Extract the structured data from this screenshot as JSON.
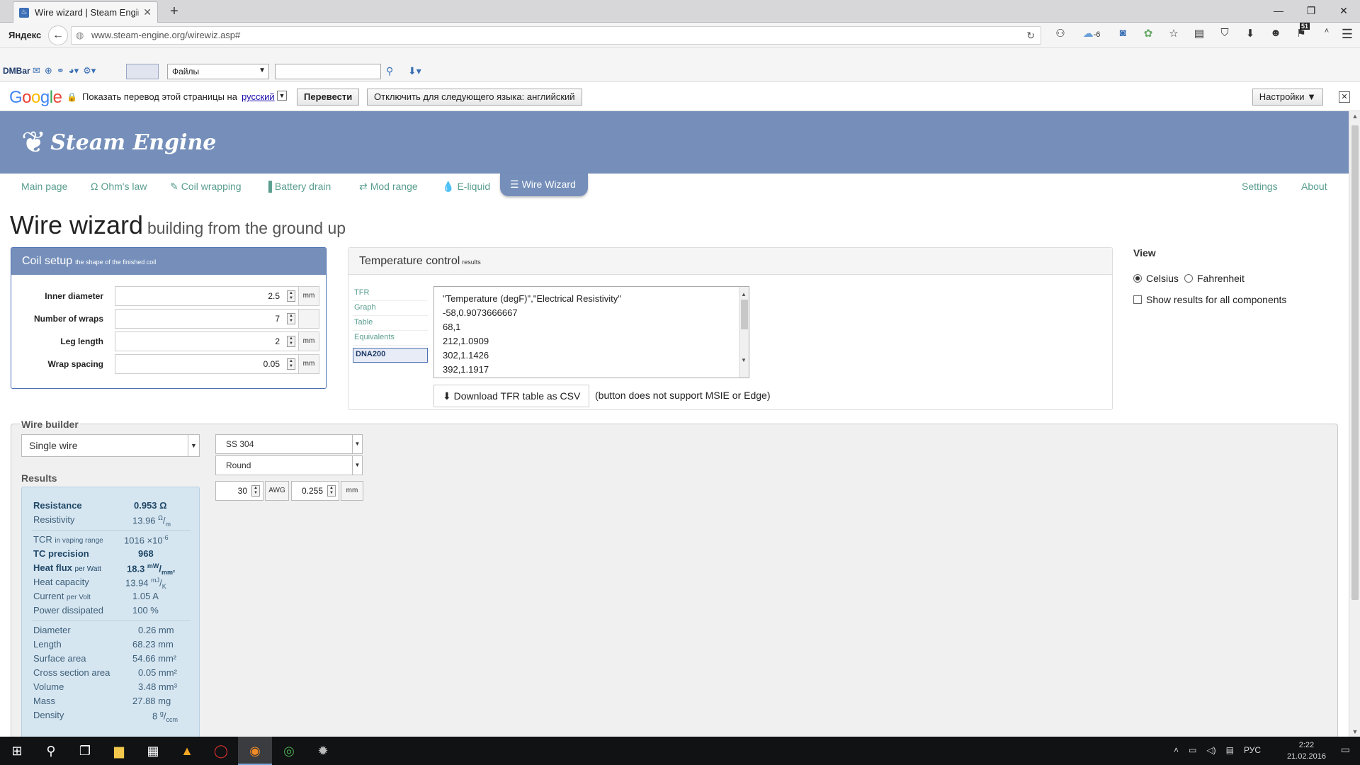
{
  "browser": {
    "tab_title": "Wire wizard | Steam Engin...",
    "tab_favicon": "steam-favicon",
    "new_tab": "+",
    "window_controls": [
      "—",
      "❐",
      "✕"
    ],
    "yandex_label": "Яндекс",
    "url": "www.steam-engine.org/wirewiz.asp#",
    "toolbar_badge_weather": "-6",
    "toolbar_badge_count": "51"
  },
  "dmbar": {
    "label": "DMBar",
    "select_value": "Файлы"
  },
  "gtranslate": {
    "prompt": "Показать перевод этой страницы на",
    "language": "русский",
    "translate_button": "Перевести",
    "disable_button": "Отключить для следующего языка: английский",
    "settings_button": "Настройки ▼"
  },
  "site": {
    "brand": "Steam Engine",
    "nav": [
      {
        "label": "Main page",
        "icon": ""
      },
      {
        "label": "Ohm's law",
        "icon": "Ω"
      },
      {
        "label": "Coil wrapping",
        "icon": "✎"
      },
      {
        "label": "Battery drain",
        "icon": "▐"
      },
      {
        "label": "Mod range",
        "icon": "⇄"
      },
      {
        "label": "E-liquid",
        "icon": "💧"
      }
    ],
    "nav_active": {
      "label": "Wire Wizard",
      "icon": "☰"
    },
    "nav_right": [
      "Settings",
      "About"
    ]
  },
  "page": {
    "title": "Wire wizard",
    "subtitle": "building from the ground up"
  },
  "coil_setup": {
    "title": "Coil setup",
    "subtitle": "the shape of the finished coil",
    "fields": [
      {
        "label": "Inner diameter",
        "value": "2.5",
        "unit": "mm"
      },
      {
        "label": "Number of wraps",
        "value": "7",
        "unit": ""
      },
      {
        "label": "Leg length",
        "value": "2",
        "unit": "mm"
      },
      {
        "label": "Wrap spacing",
        "value": "0.05",
        "unit": "mm"
      }
    ]
  },
  "temperature": {
    "title": "Temperature control",
    "subtitle": "results",
    "tabs": [
      "TFR",
      "Graph",
      "Table",
      "Equivalents"
    ],
    "selected_tab": "DNA200",
    "lines": [
      "\"Temperature (degF)\",\"Electrical Resistivity\"",
      "-58,0.9073666667",
      "68,1",
      "212,1.0909",
      "302,1.1426",
      "392,1.1917"
    ],
    "download_button": "Download TFR table as CSV",
    "download_note": "(button does not support MSIE or Edge)"
  },
  "view": {
    "title": "View",
    "celsius": "Celsius",
    "fahrenheit": "Fahrenheit",
    "show_all": "Show results for all components"
  },
  "wire_builder": {
    "legend": "Wire builder",
    "wire_type": "Single wire",
    "material": "SS 304",
    "shape": "Round",
    "awg_value": "30",
    "awg_unit": "AWG",
    "mm_value": "0.255",
    "mm_unit": "mm",
    "results_title": "Results",
    "results": {
      "resistance": {
        "label": "Resistance",
        "value": "0.953 Ω"
      },
      "resistivity": {
        "label": "Resistivity",
        "value": "13.96 ",
        "unit_top": "Ω",
        "unit_bot": "m"
      },
      "tcr": {
        "label": "TCR",
        "qualifier": "in vaping range",
        "value": "1016 ×10",
        "exp": "-6"
      },
      "tc_precision": {
        "label": "TC precision",
        "value": "968"
      },
      "heat_flux": {
        "label": "Heat flux",
        "qualifier": "per Watt",
        "value": "18.3 ",
        "unit_top": "mW",
        "unit_bot": "mm²"
      },
      "heat_capacity": {
        "label": "Heat capacity",
        "value": "13.94 ",
        "unit_top": "mJ",
        "unit_bot": "K"
      },
      "current": {
        "label": "Current",
        "qualifier": "per Volt",
        "value": "1.05 A"
      },
      "power": {
        "label": "Power dissipated",
        "value": "100  %"
      },
      "diameter": {
        "label": "Diameter",
        "value": "0.26  mm"
      },
      "length": {
        "label": "Length",
        "value": "68.23  mm"
      },
      "surface": {
        "label": "Surface area",
        "value": "54.66  mm²"
      },
      "cross": {
        "label": "Cross section area",
        "value": "0.05  mm²"
      },
      "volume": {
        "label": "Volume",
        "value": "3.48  mm³"
      },
      "mass": {
        "label": "Mass",
        "value": "27.88  mg"
      },
      "density": {
        "label": "Density",
        "value": "8 ",
        "unit_top": "g",
        "unit_bot": "ccm"
      }
    }
  },
  "taskbar": {
    "lang": "РУС",
    "time": "2:22",
    "date": "21.02.2016"
  }
}
